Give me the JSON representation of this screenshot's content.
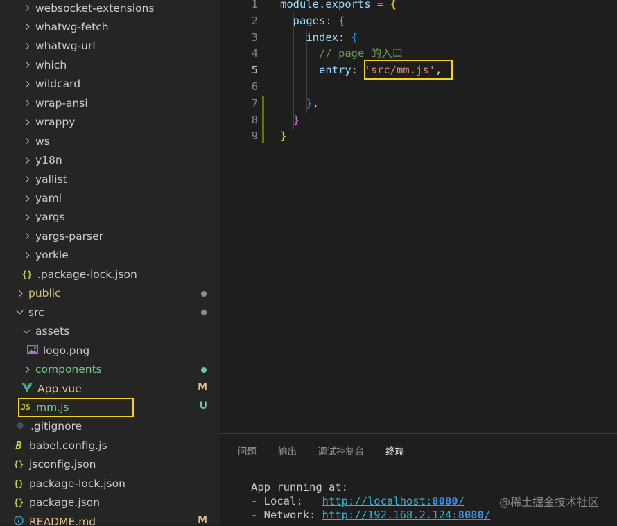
{
  "explorer": {
    "items": [
      {
        "label": "websocket-extensions",
        "kind": "folder-collapsed",
        "color": "#cccccc"
      },
      {
        "label": "whatwg-fetch",
        "kind": "folder-collapsed",
        "color": "#cccccc"
      },
      {
        "label": "whatwg-url",
        "kind": "folder-collapsed",
        "color": "#cccccc"
      },
      {
        "label": "which",
        "kind": "folder-collapsed",
        "color": "#cccccc"
      },
      {
        "label": "wildcard",
        "kind": "folder-collapsed",
        "color": "#cccccc"
      },
      {
        "label": "wrap-ansi",
        "kind": "folder-collapsed",
        "color": "#cccccc"
      },
      {
        "label": "wrappy",
        "kind": "folder-collapsed",
        "color": "#cccccc"
      },
      {
        "label": "ws",
        "kind": "folder-collapsed",
        "color": "#cccccc"
      },
      {
        "label": "y18n",
        "kind": "folder-collapsed",
        "color": "#cccccc"
      },
      {
        "label": "yallist",
        "kind": "folder-collapsed",
        "color": "#cccccc"
      },
      {
        "label": "yaml",
        "kind": "folder-collapsed",
        "color": "#cccccc"
      },
      {
        "label": "yargs",
        "kind": "folder-collapsed",
        "color": "#cccccc"
      },
      {
        "label": "yargs-parser",
        "kind": "folder-collapsed",
        "color": "#cccccc"
      },
      {
        "label": "yorkie",
        "kind": "folder-collapsed",
        "color": "#cccccc"
      },
      {
        "label": ".package-lock.json",
        "kind": "json",
        "icon_text": "{}",
        "color": "#cccccc"
      },
      {
        "label": "public",
        "kind": "folder-collapsed",
        "color": "#d7ba7d",
        "status_dot": "#8c8c8c"
      },
      {
        "label": "src",
        "kind": "folder-expanded",
        "color": "#cccccc",
        "status_dot": "#8c8c8c"
      },
      {
        "label": "assets",
        "kind": "folder-expanded",
        "color": "#cccccc"
      },
      {
        "label": "logo.png",
        "kind": "image",
        "color": "#cccccc"
      },
      {
        "label": "components",
        "kind": "folder-collapsed",
        "color": "#73c991",
        "status_dot": "#73c991"
      },
      {
        "label": "App.vue",
        "kind": "vue",
        "color": "#e2c08d",
        "status_letter": "M",
        "status_color": "#e2c08d"
      },
      {
        "label": "mm.js",
        "kind": "js",
        "icon_text": "JS",
        "color": "#73c991",
        "status_letter": "U",
        "status_color": "#73c991"
      },
      {
        "label": ".gitignore",
        "kind": "git",
        "color": "#cccccc"
      },
      {
        "label": "babel.config.js",
        "kind": "babel",
        "icon_text": "B",
        "color": "#cccccc"
      },
      {
        "label": "jsconfig.json",
        "kind": "json",
        "icon_text": "{}",
        "color": "#cccccc"
      },
      {
        "label": "package-lock.json",
        "kind": "json",
        "icon_text": "{}",
        "color": "#cccccc"
      },
      {
        "label": "package.json",
        "kind": "json",
        "icon_text": "{}",
        "color": "#cccccc"
      },
      {
        "label": "README.md",
        "kind": "info",
        "color": "#e2c08d",
        "status_letter": "M",
        "status_color": "#e2c08d"
      }
    ]
  },
  "editor": {
    "lines": [
      {
        "n": "1",
        "tokens": [
          [
            "module",
            "#9cdcfe"
          ],
          [
            ".",
            "#d4d4d4"
          ],
          [
            "exports",
            "#9cdcfe"
          ],
          [
            " = ",
            "#d4d4d4"
          ],
          [
            "{",
            "#ffd700"
          ]
        ]
      },
      {
        "n": "2",
        "tokens": [
          [
            "  pages",
            "#9cdcfe"
          ],
          [
            ": ",
            "#d4d4d4"
          ],
          [
            "{",
            "#da70d6"
          ]
        ]
      },
      {
        "n": "3",
        "tokens": [
          [
            "    index",
            "#9cdcfe"
          ],
          [
            ": ",
            "#d4d4d4"
          ],
          [
            "{",
            "#179fff"
          ]
        ]
      },
      {
        "n": "4",
        "tokens": [
          [
            "      // page 的入口",
            "#6a9955"
          ]
        ]
      },
      {
        "n": "5",
        "tokens": [
          [
            "      entry",
            "#9cdcfe"
          ],
          [
            ": ",
            "#d4d4d4"
          ],
          [
            "'src/mm.js'",
            "#ce9178"
          ],
          [
            ",",
            "#d4d4d4"
          ]
        ],
        "active": true
      },
      {
        "n": "6",
        "tokens": []
      },
      {
        "n": "7",
        "tokens": [
          [
            "    ",
            "#d4d4d4"
          ],
          [
            "}",
            "#179fff"
          ],
          [
            ",",
            "#d4d4d4"
          ]
        ]
      },
      {
        "n": "8",
        "tokens": [
          [
            "  ",
            "#d4d4d4"
          ],
          [
            "}",
            "#da70d6"
          ]
        ]
      },
      {
        "n": "9",
        "tokens": [
          [
            "}",
            "#ffd700"
          ]
        ]
      }
    ]
  },
  "panel": {
    "tabs": [
      "问题",
      "输出",
      "调试控制台",
      "终端"
    ],
    "active_tab": "终端",
    "terminal": [
      [
        [
          "App running at:",
          "#cccccc"
        ]
      ],
      [
        [
          "- Local:   ",
          "#cccccc"
        ],
        [
          "http://localhost:",
          "#29b8db"
        ],
        [
          "8080",
          "#3b8eea"
        ],
        [
          "/",
          "#29b8db"
        ]
      ],
      [
        [
          "- Network: ",
          "#cccccc"
        ],
        [
          "http://192.168.2.124:",
          "#29b8db"
        ],
        [
          "8080",
          "#3b8eea"
        ],
        [
          "/",
          "#29b8db"
        ]
      ]
    ]
  },
  "watermark": "@稀土掘金技术社区",
  "colors": {
    "highlight": "#f5d21e",
    "git_added": "#587c0c"
  }
}
